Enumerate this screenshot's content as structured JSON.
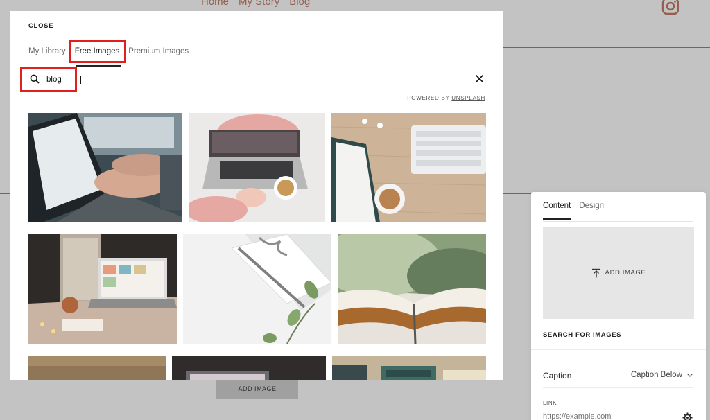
{
  "background": {
    "nav": [
      "Home",
      "My Story",
      "Blog"
    ],
    "add_image_label": "ADD IMAGE"
  },
  "modal": {
    "close_label": "CLOSE",
    "tabs": [
      {
        "label": "My Library",
        "active": false
      },
      {
        "label": "Free Images",
        "active": true
      },
      {
        "label": "Premium Images",
        "active": false
      }
    ],
    "search": {
      "value": "blog",
      "placeholder": ""
    },
    "powered_prefix": "POWERED BY",
    "powered_brand": "UNSPLASH",
    "highlight_color": "#e0201f",
    "images": [
      "laptop-typing-hands",
      "laptop-on-bed-with-coffee",
      "desk-keyboard-notebook-coffee",
      "laptop-on-table-with-candles",
      "white-envelope-with-pen-and-leaves",
      "open-old-book",
      "wooden-surface",
      "laptop-on-dark-desk",
      "typewriter-with-books"
    ]
  },
  "panel": {
    "tabs": [
      {
        "label": "Content",
        "active": true
      },
      {
        "label": "Design",
        "active": false
      }
    ],
    "add_image_label": "ADD IMAGE",
    "search_label": "SEARCH FOR IMAGES",
    "caption_label": "Caption",
    "caption_value": "Caption Below",
    "link_label": "LINK",
    "link_placeholder": "https://example.com"
  }
}
